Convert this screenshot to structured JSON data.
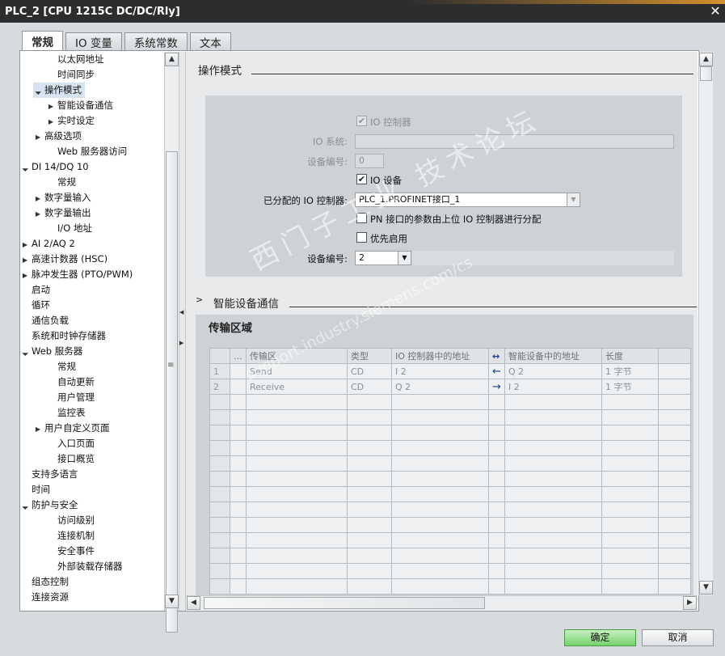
{
  "window": {
    "title": "PLC_2 [CPU 1215C DC/DC/Rly]"
  },
  "tabs": [
    "常规",
    "IO 变量",
    "系统常数",
    "文本"
  ],
  "nav": {
    "items": [
      {
        "label": "以太网地址",
        "level": 2,
        "arrow": ""
      },
      {
        "label": "时间同步",
        "level": 2,
        "arrow": ""
      },
      {
        "label": "操作模式",
        "level": 1,
        "arrow": "open",
        "selected": true
      },
      {
        "label": "智能设备通信",
        "level": 2,
        "arrow": "closed"
      },
      {
        "label": "实时设定",
        "level": 2,
        "arrow": "closed"
      },
      {
        "label": "高级选项",
        "level": 1,
        "arrow": "closed"
      },
      {
        "label": "Web 服务器访问",
        "level": 2,
        "arrow": ""
      },
      {
        "label": "DI 14/DQ 10",
        "level": 0,
        "arrow": "open"
      },
      {
        "label": "常规",
        "level": 2,
        "arrow": ""
      },
      {
        "label": "数字量输入",
        "level": 1,
        "arrow": "closed"
      },
      {
        "label": "数字量输出",
        "level": 1,
        "arrow": "closed"
      },
      {
        "label": "I/O 地址",
        "level": 2,
        "arrow": ""
      },
      {
        "label": "AI 2/AQ 2",
        "level": 0,
        "arrow": "closed"
      },
      {
        "label": "高速计数器 (HSC)",
        "level": 0,
        "arrow": "closed"
      },
      {
        "label": "脉冲发生器 (PTO/PWM)",
        "level": 0,
        "arrow": "closed"
      },
      {
        "label": "启动",
        "level": 0,
        "arrow": ""
      },
      {
        "label": "循环",
        "level": 0,
        "arrow": ""
      },
      {
        "label": "通信负载",
        "level": 0,
        "arrow": ""
      },
      {
        "label": "系统和时钟存储器",
        "level": 0,
        "arrow": ""
      },
      {
        "label": "Web 服务器",
        "level": 0,
        "arrow": "open"
      },
      {
        "label": "常规",
        "level": 2,
        "arrow": ""
      },
      {
        "label": "自动更新",
        "level": 2,
        "arrow": ""
      },
      {
        "label": "用户管理",
        "level": 2,
        "arrow": ""
      },
      {
        "label": "监控表",
        "level": 2,
        "arrow": ""
      },
      {
        "label": "用户自定义页面",
        "level": 1,
        "arrow": "closed"
      },
      {
        "label": "入口页面",
        "level": 2,
        "arrow": ""
      },
      {
        "label": "接口概览",
        "level": 2,
        "arrow": ""
      },
      {
        "label": "支持多语言",
        "level": 0,
        "arrow": ""
      },
      {
        "label": "时间",
        "level": 0,
        "arrow": ""
      },
      {
        "label": "防护与安全",
        "level": 0,
        "arrow": "open"
      },
      {
        "label": "访问级别",
        "level": 2,
        "arrow": ""
      },
      {
        "label": "连接机制",
        "level": 2,
        "arrow": ""
      },
      {
        "label": "安全事件",
        "level": 2,
        "arrow": ""
      },
      {
        "label": "外部装载存储器",
        "level": 2,
        "arrow": ""
      },
      {
        "label": "组态控制",
        "level": 0,
        "arrow": ""
      },
      {
        "label": "连接资源",
        "level": 0,
        "arrow": ""
      }
    ]
  },
  "operation_mode": {
    "title": "操作模式",
    "io_controller_label": "IO 控制器",
    "io_system_label": "IO 系统:",
    "io_system_value": "",
    "device_number_label_dis": "设备编号:",
    "device_number_value_dis": "0",
    "io_device_label": "IO 设备",
    "assigned_controller_label": "已分配的 IO 控制器:",
    "assigned_controller_value": "PLC_1.PROFINET接口_1",
    "pn_param_label": "PN 接口的参数由上位 IO 控制器进行分配",
    "priority_label": "优先启用",
    "device_number_label": "设备编号:",
    "device_number_value": "2"
  },
  "smart_device": {
    "title": "智能设备通信",
    "transfer_title": "传输区域",
    "columns": [
      "...",
      "传输区",
      "类型",
      "IO 控制器中的地址",
      "↔",
      "智能设备中的地址",
      "长度"
    ],
    "rows": [
      {
        "num": "1",
        "area": "Send",
        "type": "CD",
        "ctrl_addr": "I 2",
        "dir": "←",
        "dev_addr": "Q 2",
        "length": "1 字节"
      },
      {
        "num": "2",
        "area": "Receive",
        "type": "CD",
        "ctrl_addr": "Q 2",
        "dir": "→",
        "dev_addr": "I 2",
        "length": "1 字节"
      }
    ]
  },
  "watermark": {
    "line1": "西门子工业  技术论坛",
    "line2": "support.industry.siemens.com/cs"
  },
  "buttons": {
    "ok": "确定",
    "cancel": "取消"
  }
}
